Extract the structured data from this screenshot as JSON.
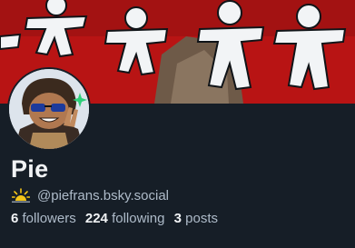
{
  "profile": {
    "display_name": "Pie",
    "status_icon": "sun-emoji-icon",
    "handle": "@piefrans.bsky.social",
    "followers_count": "6",
    "followers_label": "followers",
    "following_count": "224",
    "following_label": "following",
    "posts_count": "3",
    "posts_label": "posts"
  },
  "colors": {
    "background": "#161e27",
    "banner_red": "#b81414",
    "text_primary": "#f1f3f5",
    "text_secondary": "#aebbc9"
  }
}
